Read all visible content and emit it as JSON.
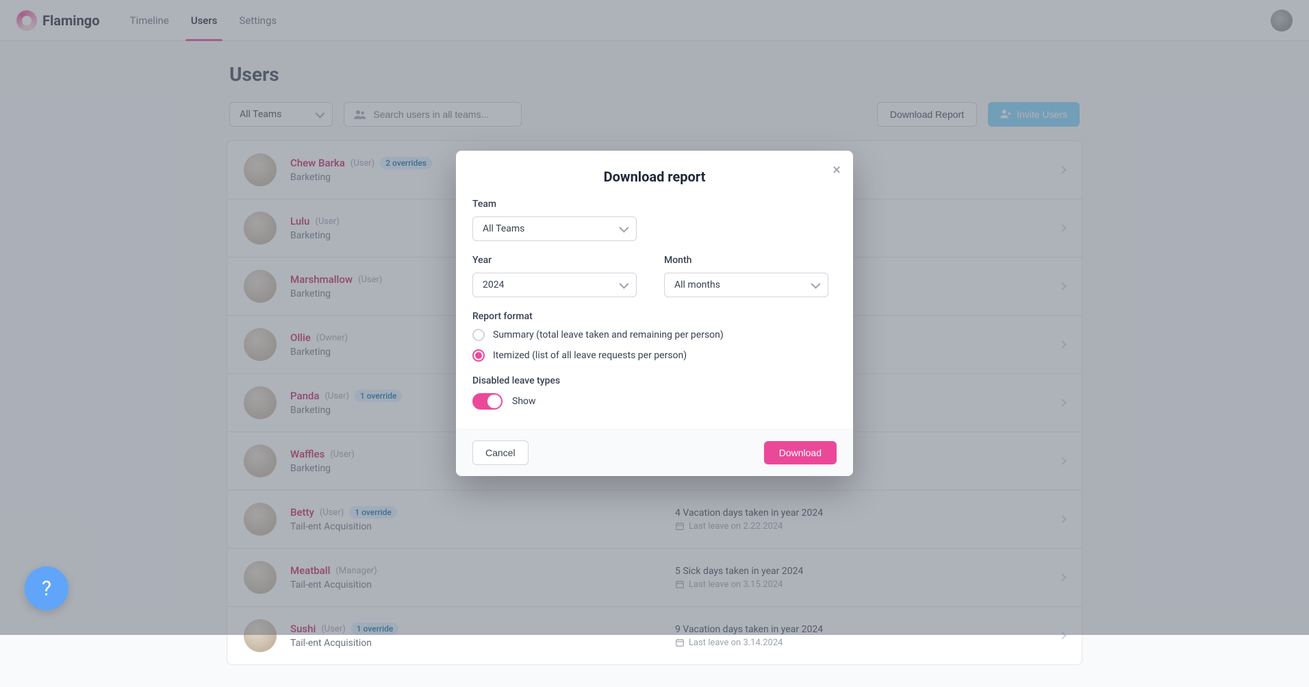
{
  "brand": "Flamingo",
  "nav": [
    {
      "label": "Timeline",
      "active": false
    },
    {
      "label": "Users",
      "active": true
    },
    {
      "label": "Settings",
      "active": false
    }
  ],
  "page_title": "Users",
  "team_filter": "All Teams",
  "search_placeholder": "Search users in all teams...",
  "download_report_btn": "Download Report",
  "invite_users_btn": "Invite Users",
  "users": [
    {
      "name": "Chew Barka",
      "role": "(User)",
      "override": "2 overrides",
      "team": "Barketing",
      "leave_summary": "",
      "last_leave": ""
    },
    {
      "name": "Lulu",
      "role": "(User)",
      "override": "",
      "team": "Barketing",
      "leave_summary": "",
      "last_leave": ""
    },
    {
      "name": "Marshmallow",
      "role": "(User)",
      "override": "",
      "team": "Barketing",
      "leave_summary": "",
      "last_leave": ""
    },
    {
      "name": "Ollie",
      "role": "(Owner)",
      "override": "",
      "team": "Barketing",
      "leave_summary": "",
      "last_leave": ""
    },
    {
      "name": "Panda",
      "role": "(User)",
      "override": "1 override",
      "team": "Barketing",
      "leave_summary": "",
      "last_leave": ""
    },
    {
      "name": "Waffles",
      "role": "(User)",
      "override": "",
      "team": "Barketing",
      "leave_summary": "",
      "last_leave": ""
    },
    {
      "name": "Betty",
      "role": "(User)",
      "override": "1 override",
      "team": "Tail-ent Acquisition",
      "leave_summary": "4 Vacation days taken in year 2024",
      "last_leave": "Last leave on 2.22.2024"
    },
    {
      "name": "Meatball",
      "role": "(Manager)",
      "override": "",
      "team": "Tail-ent Acquisition",
      "leave_summary": "5 Sick days taken in year 2024",
      "last_leave": "Last leave on 3.15.2024"
    },
    {
      "name": "Sushi",
      "role": "(User)",
      "override": "1 override",
      "team": "Tail-ent Acquisition",
      "leave_summary": "9 Vacation days taken in year 2024",
      "last_leave": "Last leave on 3.14.2024"
    }
  ],
  "modal": {
    "title": "Download report",
    "team_label": "Team",
    "team_value": "All Teams",
    "year_label": "Year",
    "year_value": "2024",
    "month_label": "Month",
    "month_value": "All months",
    "format_label": "Report format",
    "format_options": [
      {
        "label": "Summary (total leave taken and remaining per person)",
        "checked": false
      },
      {
        "label": "Itemized (list of all leave requests per person)",
        "checked": true
      }
    ],
    "disabled_label": "Disabled leave types",
    "disabled_toggle_label": "Show",
    "cancel": "Cancel",
    "download": "Download"
  },
  "help_label": "?"
}
